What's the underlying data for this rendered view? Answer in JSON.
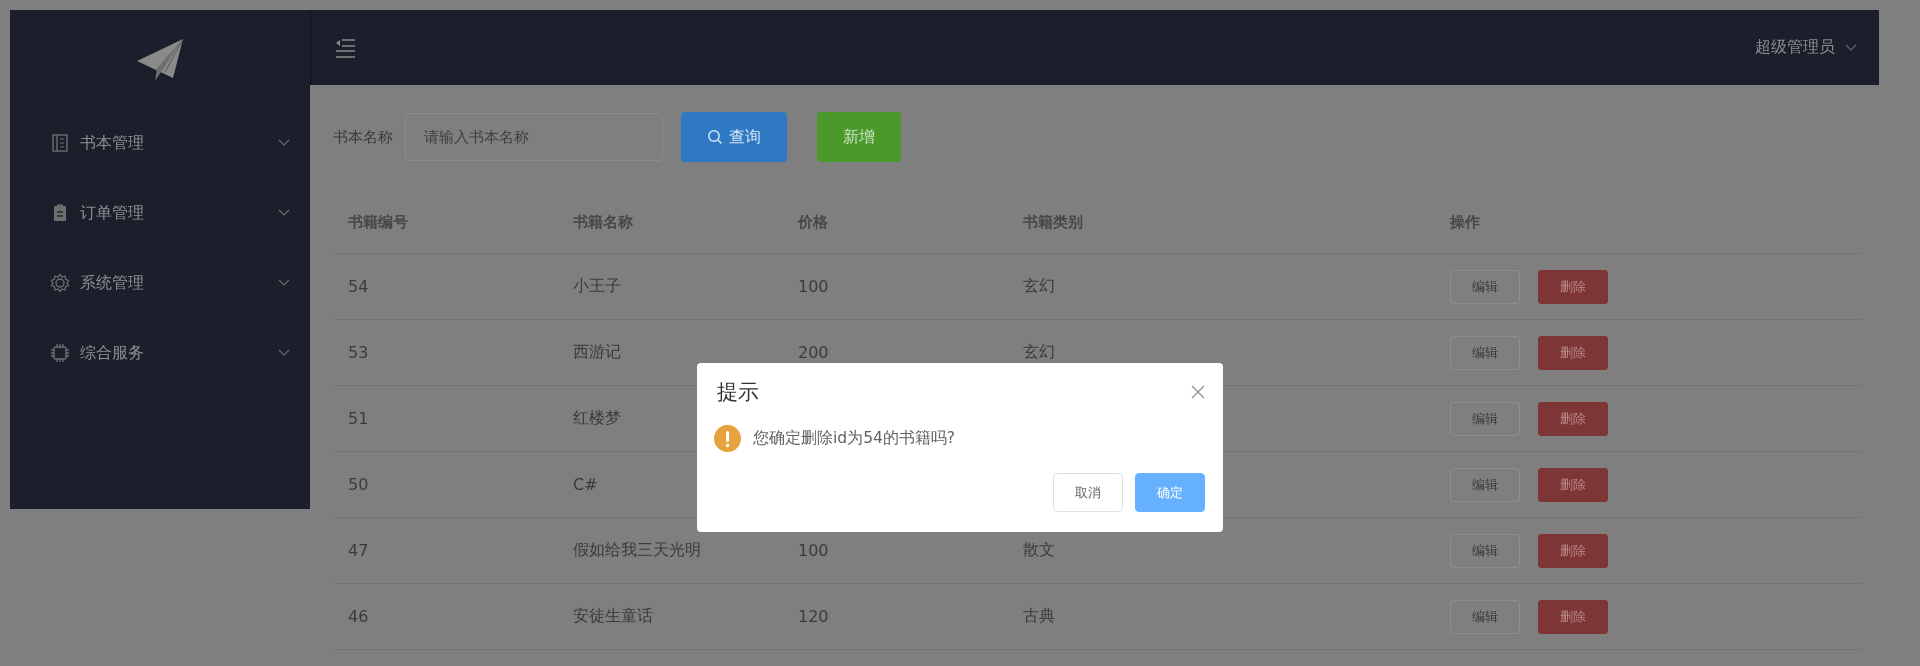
{
  "sidebar": {
    "items": [
      {
        "label": "书本管理",
        "expanded": false
      },
      {
        "label": "订单管理",
        "expanded": false
      },
      {
        "label": "系统管理",
        "expanded": false
      },
      {
        "label": "综合服务",
        "expanded": false
      }
    ]
  },
  "header": {
    "user": "超级管理员"
  },
  "search": {
    "label": "书本名称",
    "placeholder": "请输入书本名称",
    "buttons": [
      {
        "kind": "query",
        "label": "查询"
      },
      {
        "kind": "add",
        "label": "新增"
      }
    ]
  },
  "table": {
    "columns": [
      "书籍编号",
      "书籍名称",
      "价格",
      "书籍类别",
      "操作"
    ],
    "rows": [
      {
        "id": "54",
        "name": "小王子",
        "price": "100",
        "category": "玄幻",
        "actions": [
          "编辑",
          "删除"
        ]
      },
      {
        "id": "53",
        "name": "西游记",
        "price": "200",
        "category": "玄幻",
        "actions": [
          "编辑",
          "删除"
        ]
      },
      {
        "id": "51",
        "name": "红楼梦",
        "actions": [
          "编辑",
          "删除"
        ]
      },
      {
        "id": "50",
        "name": "C#",
        "actions": [
          "编辑",
          "删除"
        ]
      },
      {
        "id": "47",
        "name": "假如给我三天光明",
        "price": "100",
        "category": "散文",
        "actions": [
          "编辑",
          "删除"
        ]
      },
      {
        "id": "46",
        "name": "安徒生童话",
        "price": "120",
        "category": "古典",
        "actions": [
          "编辑",
          "删除"
        ]
      }
    ]
  },
  "dialog": {
    "title": "提示",
    "message": "您确定删除id为54的书籍吗?",
    "buttons": [
      {
        "kind": "cancel",
        "label": "取消"
      },
      {
        "kind": "confirm",
        "label": "确定"
      }
    ]
  }
}
